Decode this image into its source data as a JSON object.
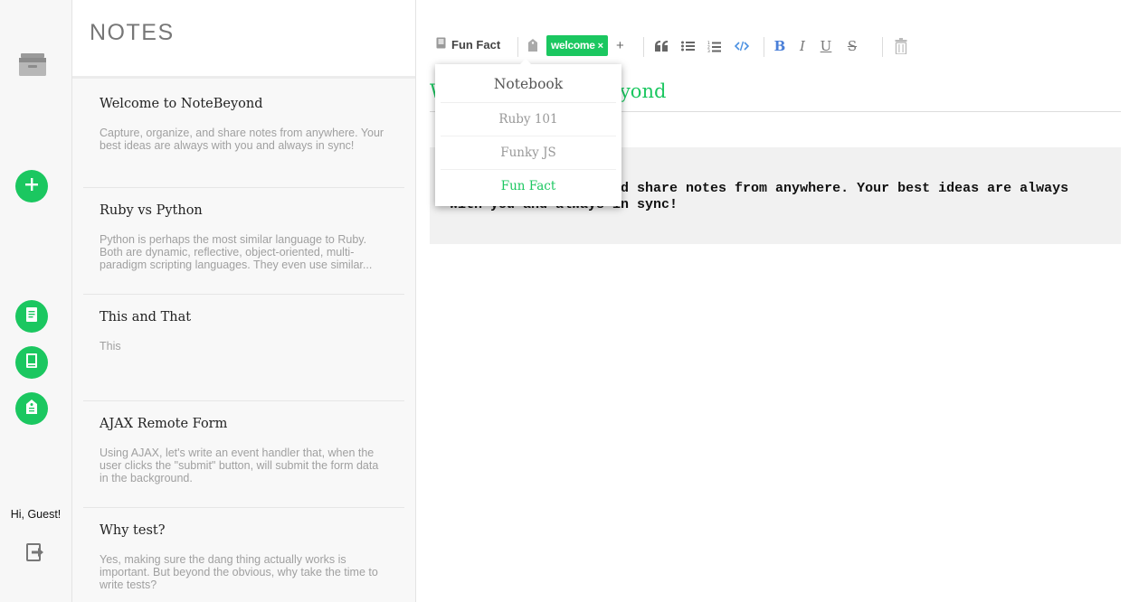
{
  "rail": {
    "logo_icon": "filing-cabinet-icon",
    "new_note_icon": "plus-icon",
    "nav_icons": [
      "notes-icon",
      "notebook-icon",
      "tag-icon"
    ],
    "greeting": "Hi, Guest!",
    "logout_icon": "logout-icon",
    "accent_color": "#1bc760"
  },
  "notes": {
    "title": "NOTES",
    "items": [
      {
        "title": "Welcome to NoteBeyond",
        "body": "Capture, organize, and share notes from anywhere. Your best ideas are always with you and always in sync!"
      },
      {
        "title": "Ruby vs Python",
        "body": "Python is perhaps the most similar language to Ruby. Both are dynamic, reflective, object-oriented, multi-paradigm scripting languages. They even use similar..."
      },
      {
        "title": "This and That",
        "body": "This"
      },
      {
        "title": "AJAX Remote Form",
        "body": "Using AJAX, let's write an event handler that, when the user clicks the \"submit\" button, will submit the form data in the background."
      },
      {
        "title": "Why test?",
        "body": "Yes, making sure the dang thing actually works is important. But beyond the obvious, why take the time to write tests?"
      }
    ]
  },
  "editor": {
    "notebook_label": "Fun Fact",
    "tag_label": "welcome",
    "tag_remove": "×",
    "add_tag": "+",
    "toolbar_icons": [
      "quote-icon",
      "bullet-list-icon",
      "numbered-list-icon",
      "code-icon",
      "bold-icon",
      "italic-icon",
      "underline-icon",
      "strikethrough-icon",
      "trash-icon"
    ],
    "bold_label": "B",
    "italic_label": "I",
    "underline_label": "U",
    "strike_label": "S",
    "note_title": "Welcome to NoteBeyond",
    "note_body": "Capture, organize, and share notes from anywhere. Your best ideas are always with you and always in sync!"
  },
  "dropdown": {
    "header": "Notebook",
    "items": [
      "Ruby 101",
      "Funky JS",
      "Fun Fact"
    ],
    "selected": "Fun Fact"
  }
}
